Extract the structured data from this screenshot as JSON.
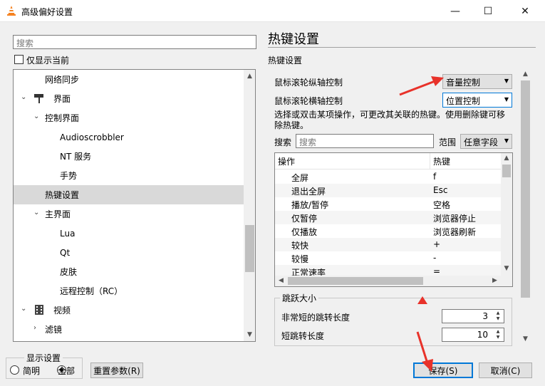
{
  "window": {
    "title": "高级偏好设置",
    "min_glyph": "—",
    "max_glyph": "☐",
    "close_glyph": "✕"
  },
  "left": {
    "search_placeholder": "搜索",
    "show_current_label": "仅显示当前",
    "tree": [
      {
        "label": "网络同步",
        "level": 1,
        "expand": ""
      },
      {
        "label": "界面",
        "level": 0,
        "expand": "⌄",
        "icon": "paint-roller-icon"
      },
      {
        "label": "控制界面",
        "level": 1,
        "expand": "⌄"
      },
      {
        "label": "Audioscrobbler",
        "level": 2,
        "expand": ""
      },
      {
        "label": "NT 服务",
        "level": 2,
        "expand": ""
      },
      {
        "label": "手势",
        "level": 2,
        "expand": ""
      },
      {
        "label": "热键设置",
        "level": 1,
        "expand": "",
        "selected": true
      },
      {
        "label": "主界面",
        "level": 1,
        "expand": "⌄"
      },
      {
        "label": "Lua",
        "level": 2,
        "expand": ""
      },
      {
        "label": "Qt",
        "level": 2,
        "expand": ""
      },
      {
        "label": "皮肤",
        "level": 2,
        "expand": ""
      },
      {
        "label": "远程控制（RC）",
        "level": 2,
        "expand": ""
      },
      {
        "label": "视频",
        "level": 0,
        "expand": "⌄",
        "icon": "film-icon"
      },
      {
        "label": "滤镜",
        "level": 1,
        "expand": "›"
      }
    ],
    "display_group_title": "显示设置",
    "radio_simple": "简明",
    "radio_all": "全部",
    "reset_button": "重置参数(R)"
  },
  "right": {
    "panel_title": "热键设置",
    "section_label": "热键设置",
    "wheel_vertical_label": "鼠标滚轮纵轴控制",
    "wheel_vertical_value": "音量控制",
    "wheel_horizontal_label": "鼠标滚轮横轴控制",
    "wheel_horizontal_value": "位置控制",
    "description": "选择或双击某项操作，可更改其关联的热键。使用删除键可移除热键。",
    "search_label": "搜索",
    "search_placeholder": "搜索",
    "scope_label": "范围",
    "scope_value": "任意字段",
    "table": {
      "headers": [
        "操作",
        "热键"
      ],
      "rows": [
        [
          "全屏",
          "f"
        ],
        [
          "退出全屏",
          "Esc"
        ],
        [
          "播放/暂停",
          "空格"
        ],
        [
          "仅暂停",
          "浏览器停止"
        ],
        [
          "仅播放",
          "浏览器刷新"
        ],
        [
          "较快",
          "+"
        ],
        [
          "较慢",
          "-"
        ],
        [
          "正常速率",
          "="
        ]
      ]
    },
    "jump_group_title": "跳跃大小",
    "very_short_jump_label": "非常短的跳转长度",
    "very_short_jump_value": "3",
    "short_jump_label": "短跳转长度",
    "short_jump_value": "10"
  },
  "footer": {
    "save_button": "保存(S)",
    "cancel_button": "取消(C)"
  },
  "colors": {
    "annotation_red": "#e8322a",
    "accent": "#0078d7"
  }
}
